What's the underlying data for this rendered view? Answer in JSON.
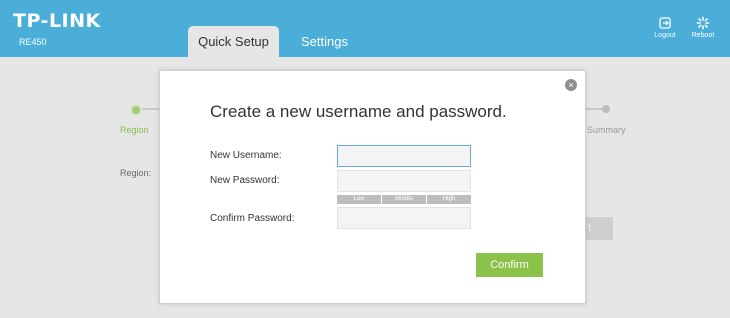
{
  "brand": {
    "logo": "TP-LINK",
    "model": "RE450"
  },
  "tabs": [
    {
      "label": "Quick Setup",
      "active": true
    },
    {
      "label": "Settings",
      "active": false
    }
  ],
  "header_actions": {
    "logout": "Logout",
    "reboot": "Reboot"
  },
  "background": {
    "steps": {
      "region": "Region",
      "summary": "Summary"
    },
    "region_field_label": "Region:",
    "next_button_fragment": "t"
  },
  "modal": {
    "title": "Create a new username and password.",
    "username_label": "New Username:",
    "password_label": "New Password:",
    "confirm_label": "Confirm Password:",
    "username_value": "",
    "password_value": "",
    "confirm_value": "",
    "strength": [
      "Low",
      "Middle",
      "High"
    ],
    "confirm_button": "Confirm",
    "close_glyph": "×"
  },
  "colors": {
    "header": "#4aaed9",
    "accent_green": "#8bc34a",
    "strength_bar": "#bdbdbd"
  },
  "icons": {
    "logout": "logout-icon",
    "reboot": "reboot-icon",
    "close": "close-icon"
  }
}
